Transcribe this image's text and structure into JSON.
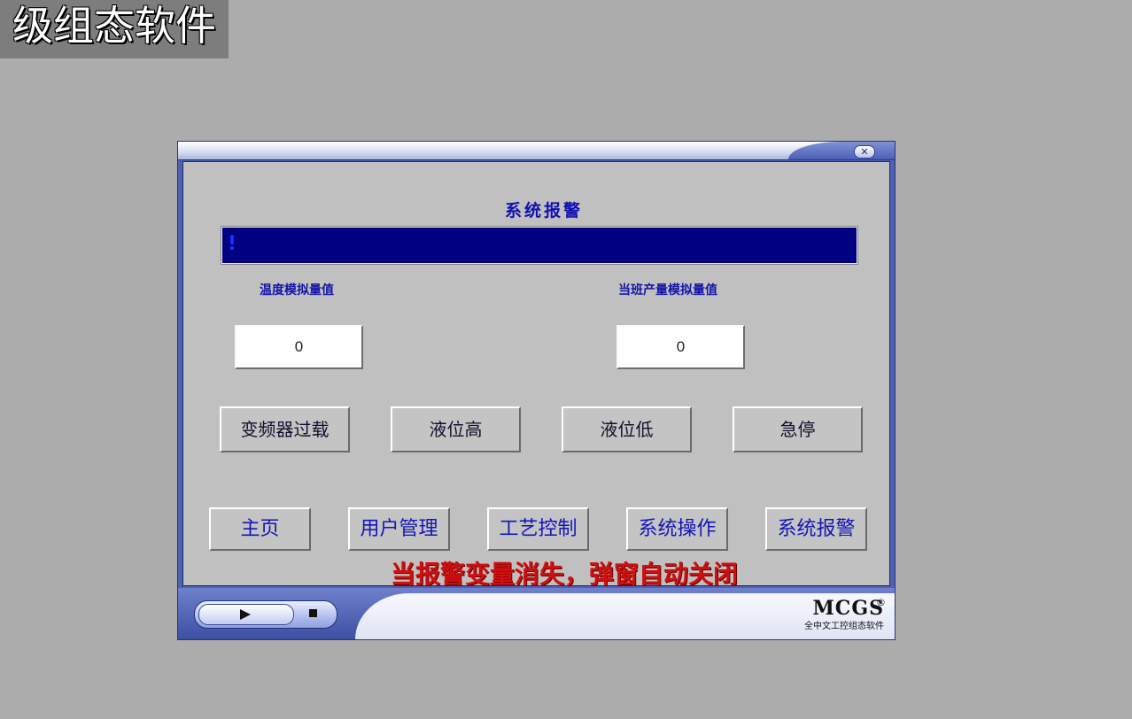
{
  "banner": {
    "text": "级组态软件"
  },
  "window": {
    "close_icon_glyph": "✕"
  },
  "alarm": {
    "title": "系统报警",
    "bar_marker": "!",
    "bar_color": "#000080"
  },
  "values": {
    "temperature_label": "温度模拟量值",
    "temperature_value": "0",
    "output_label": "当班产量模拟量值",
    "output_value": "0"
  },
  "alarm_buttons": [
    {
      "label": "变频器过载"
    },
    {
      "label": "液位高"
    },
    {
      "label": "液位低"
    },
    {
      "label": "急停"
    }
  ],
  "nav_buttons": [
    {
      "label": "主页"
    },
    {
      "label": "用户管理"
    },
    {
      "label": "工艺控制"
    },
    {
      "label": "系统操作"
    },
    {
      "label": "系统报警"
    }
  ],
  "note": "当报警变量消失，弹窗自动关闭",
  "footer": {
    "brand": "MCGS",
    "registered": "®",
    "subtitle": "全中文工控组态软件",
    "icons": [
      "play-icon",
      "stop-icon"
    ]
  }
}
